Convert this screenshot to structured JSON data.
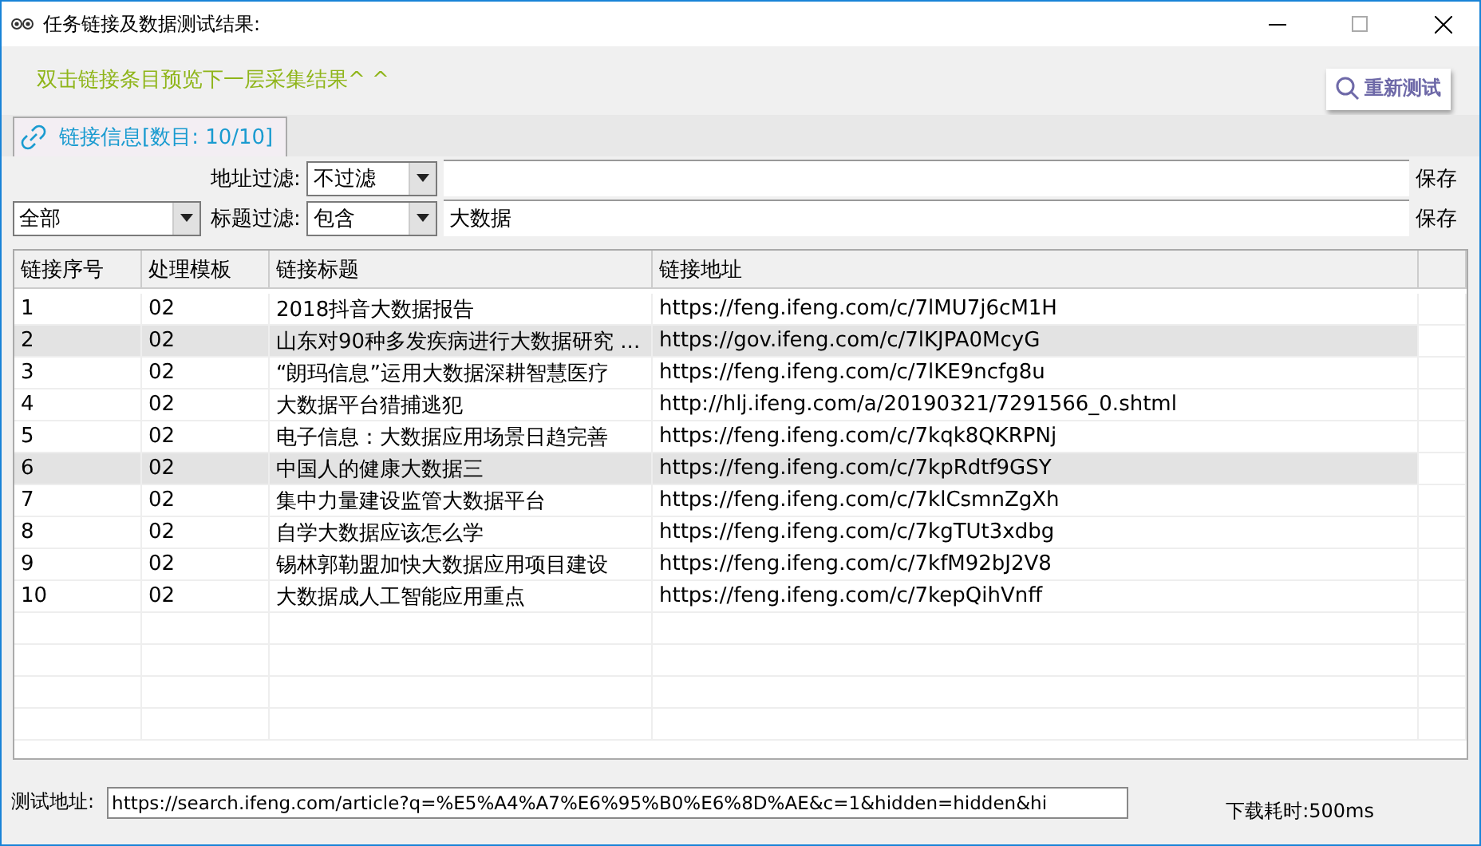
{
  "window": {
    "title": "任务链接及数据测试结果:"
  },
  "hint": "双击链接条目预览下一层采集结果^ ^",
  "retest_button": {
    "label": "重新测试"
  },
  "tabs": [
    {
      "label": "链接信息[数目: 10/10]",
      "selected": true
    }
  ],
  "scope_select": {
    "value": "全部"
  },
  "filters": [
    {
      "label": "地址过滤:",
      "mode": "不过滤",
      "save": "保存"
    },
    {
      "label": "标题过滤:",
      "mode": "包含",
      "value": "大数据",
      "save": "保存"
    }
  ],
  "table": {
    "columns": [
      "链接序号",
      "处理模板",
      "链接标题",
      "链接地址"
    ],
    "rows": [
      {
        "cells": [
          "1",
          "02",
          "2018抖音大数据报告",
          "https://feng.ifeng.com/c/7lMU7j6cM1H"
        ],
        "selected": false
      },
      {
        "cells": [
          "2",
          "02",
          "山东对90种多发疾病进行大数据研究 ...",
          "https://gov.ifeng.com/c/7lKJPA0McyG"
        ],
        "selected": true
      },
      {
        "cells": [
          "3",
          "02",
          "“朗玛信息”运用大数据深耕智慧医疗",
          "https://feng.ifeng.com/c/7lKE9ncfg8u"
        ],
        "selected": false
      },
      {
        "cells": [
          "4",
          "02",
          "大数据平台猎捕逃犯",
          "http://hlj.ifeng.com/a/20190321/7291566_0.shtml"
        ],
        "selected": false
      },
      {
        "cells": [
          "5",
          "02",
          "电子信息：大数据应用场景日趋完善",
          "https://feng.ifeng.com/c/7kqk8QKRPNj"
        ],
        "selected": false
      },
      {
        "cells": [
          "6",
          "02",
          "中国人的健康大数据三",
          "https://feng.ifeng.com/c/7kpRdtf9GSY"
        ],
        "selected": true
      },
      {
        "cells": [
          "7",
          "02",
          "集中力量建设监管大数据平台",
          "https://feng.ifeng.com/c/7klCsmnZgXh"
        ],
        "selected": false
      },
      {
        "cells": [
          "8",
          "02",
          "自学大数据应该怎么学",
          "https://feng.ifeng.com/c/7kgTUt3xdbg"
        ],
        "selected": false
      },
      {
        "cells": [
          "9",
          "02",
          "锡林郭勒盟加快大数据应用项目建设",
          "https://feng.ifeng.com/c/7kfM92bJ2V8"
        ],
        "selected": false
      },
      {
        "cells": [
          "10",
          "02",
          "大数据成人工智能应用重点",
          "https://feng.ifeng.com/c/7kepQihVnff"
        ],
        "selected": false
      }
    ]
  },
  "status": {
    "url_label": "测试地址:",
    "url": "https://search.ifeng.com/article?q=%E5%A4%A7%E6%95%B0%E6%8D%AE&c=1&hidden=hidden&hi",
    "timing": "下载耗时:500ms"
  }
}
